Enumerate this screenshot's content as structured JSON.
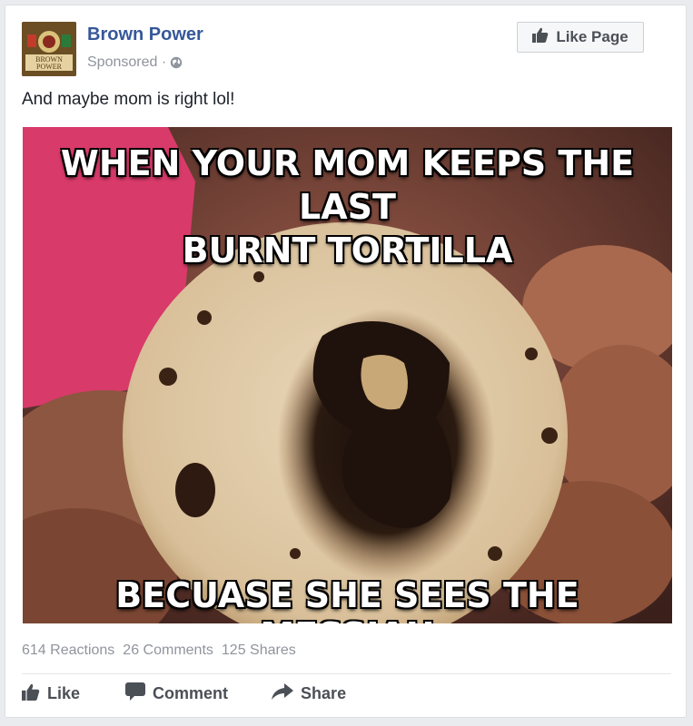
{
  "page": {
    "name": "Brown Power",
    "sponsored": "Sponsored ·",
    "logo_text": "BROWN POWER",
    "like_page_label": "Like Page"
  },
  "post": {
    "caption": "And maybe mom is right lol!",
    "image": {
      "top_text_line1": "WHEN YOUR MOM KEEPS THE LAST",
      "top_text_line2": "BURNT TORTILLA",
      "bottom_text": "BECUASE SHE SEES THE MESSIAH"
    }
  },
  "stats": {
    "reactions": "614 Reactions",
    "comments": "26 Comments",
    "shares": "125 Shares"
  },
  "actions": {
    "like": "Like",
    "comment": "Comment",
    "share": "Share"
  },
  "colors": {
    "page_name": "#365899",
    "meta_text": "#90949c",
    "action_text": "#4b4f56"
  },
  "icons": {
    "privacy": "globe-icon",
    "like_page": "thumbs-up-icon",
    "like": "thumbs-up-icon",
    "comment": "speech-bubble-icon",
    "share": "share-arrow-icon"
  }
}
